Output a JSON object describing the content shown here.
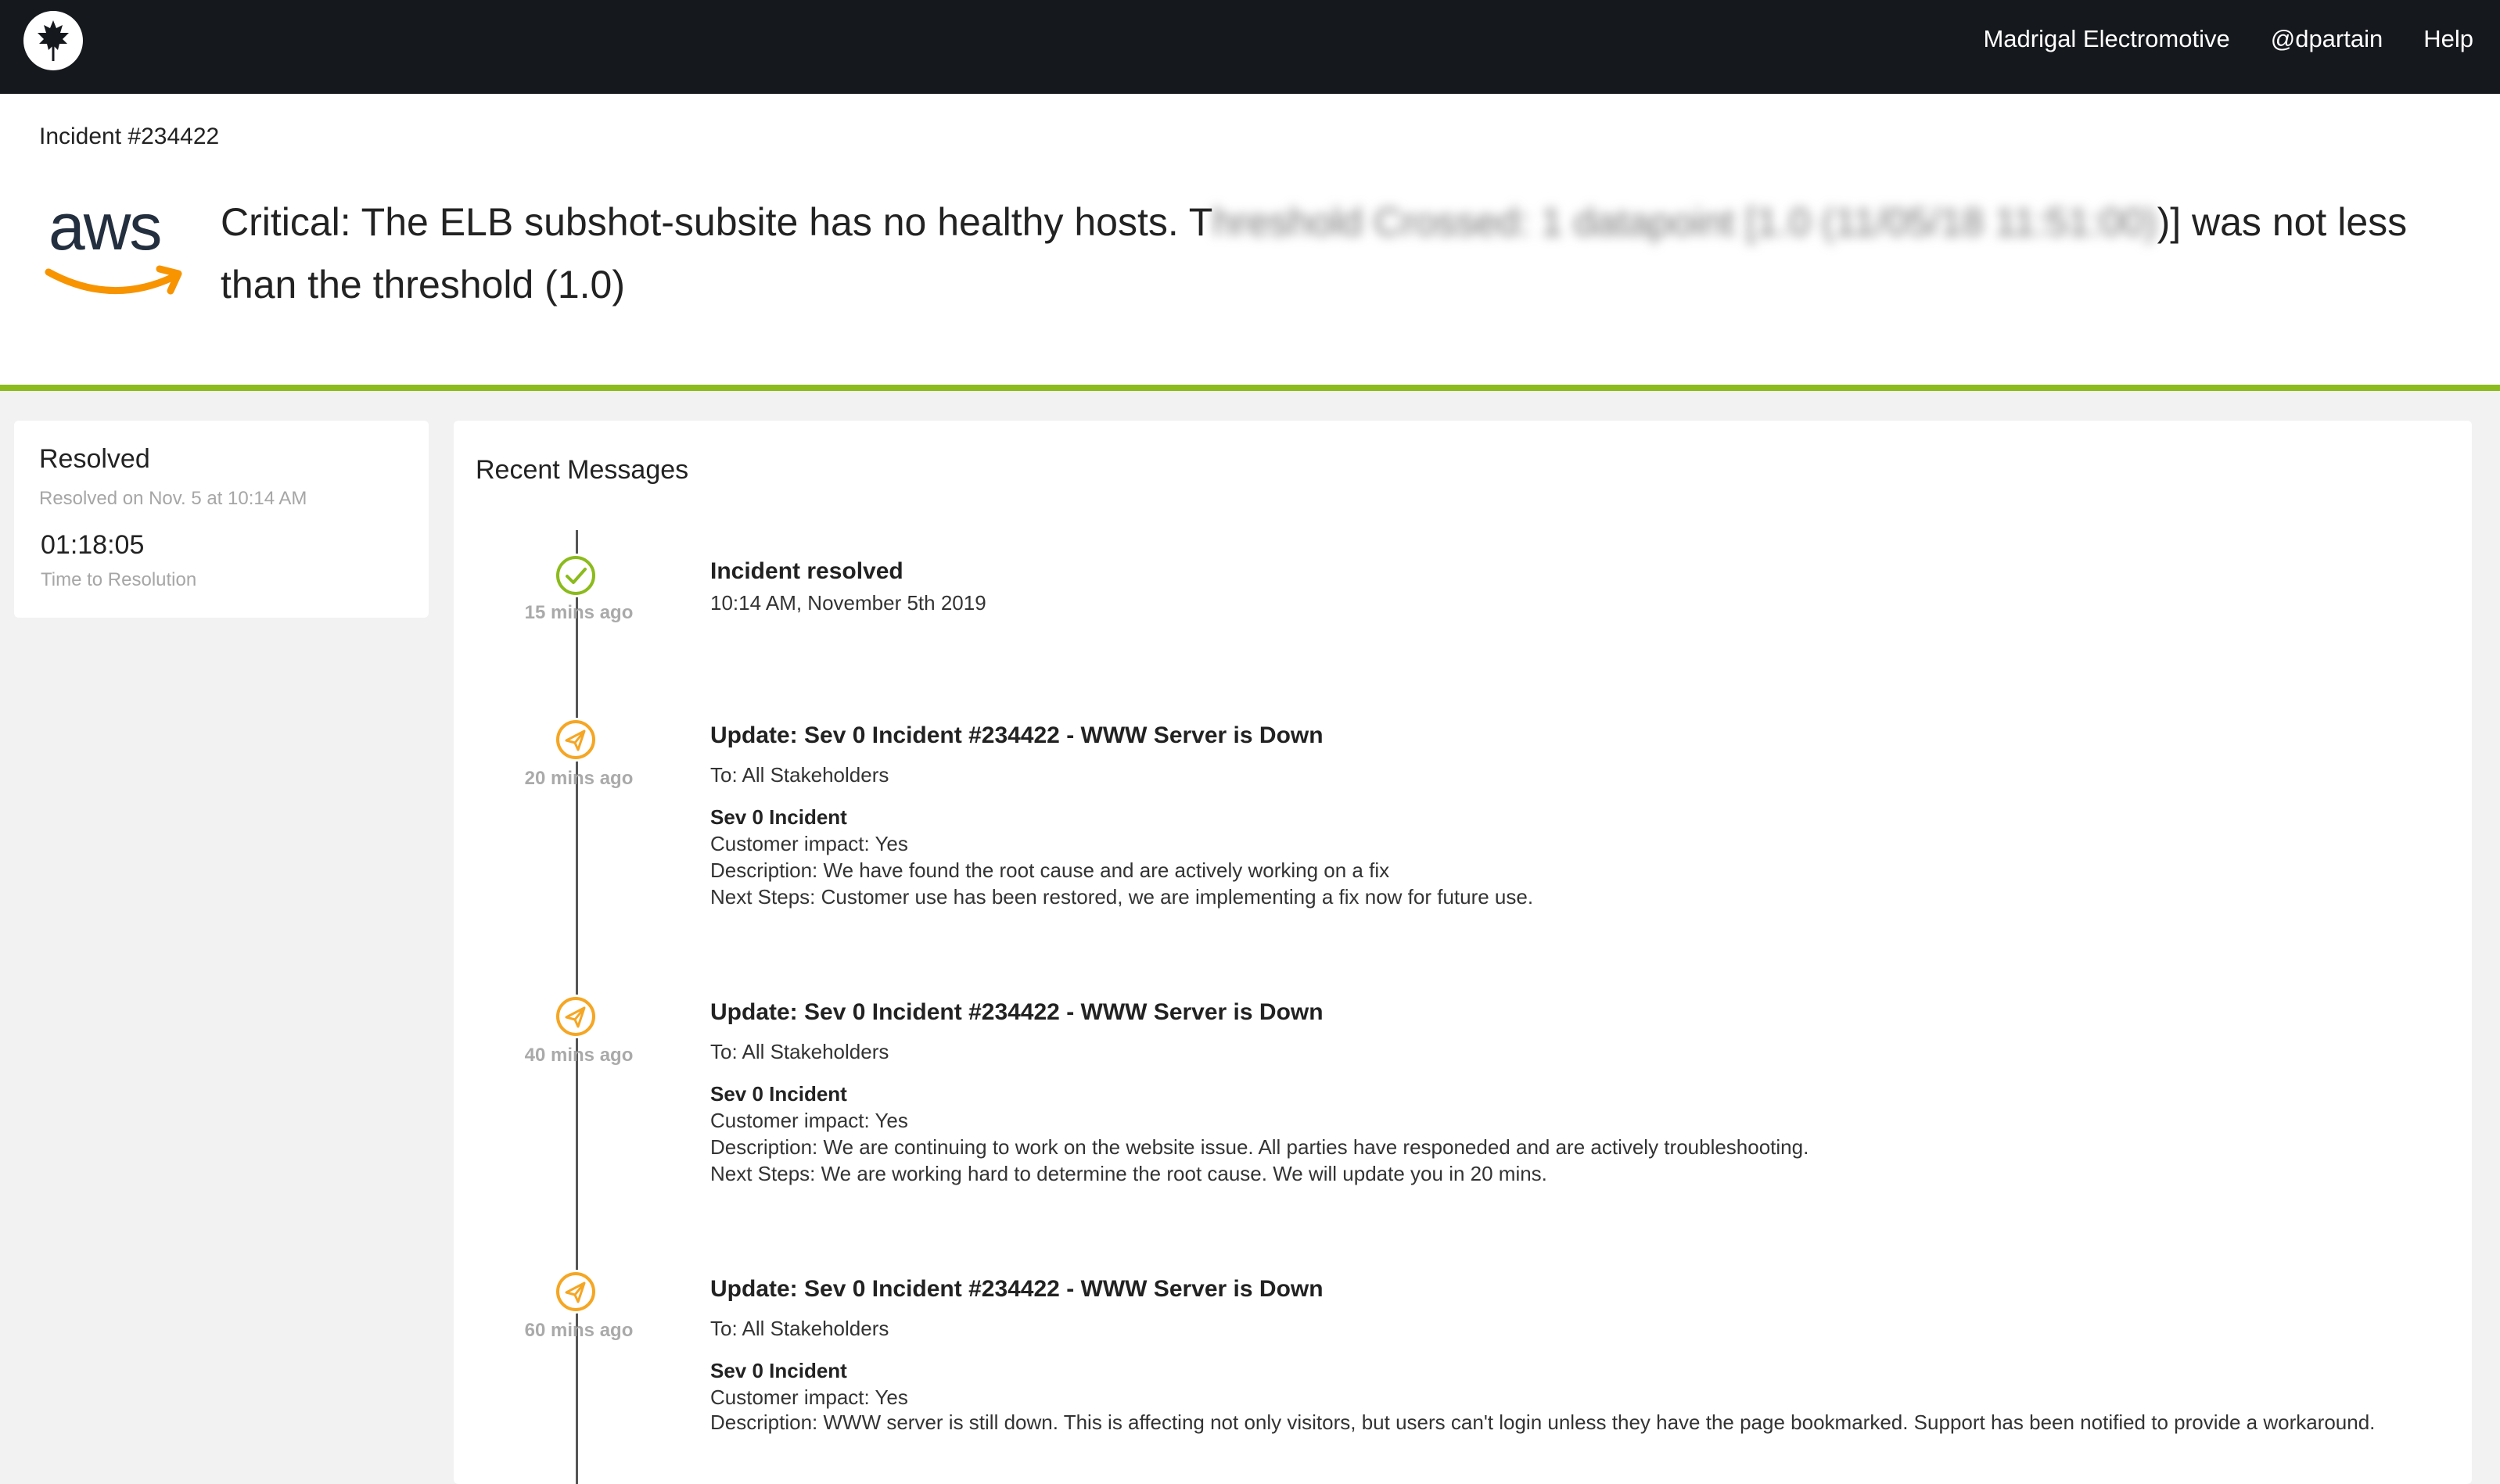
{
  "nav": {
    "org": "Madrigal Electromotive",
    "user": "@dpartain",
    "help": "Help"
  },
  "header": {
    "incident_id": "Incident #234422",
    "logo_text": "aws",
    "headline_start": "Critical: The ELB subshot-subsite has no healthy hosts. T",
    "headline_blurred": "hreshold Crossed: 1 datapoint [1.0 (11/05/18 11:51:00)",
    "headline_end": ")] was not less than the threshold (1.0)"
  },
  "status": {
    "title": "Resolved",
    "resolved_on": "Resolved on Nov. 5 at 10:14 AM",
    "ttr_value": "01:18:05",
    "ttr_label": "Time to Resolution"
  },
  "messages": {
    "title": "Recent Messages",
    "entries": [
      {
        "icon": "check-circle-icon",
        "ago": "15 mins ago",
        "title": "Incident resolved",
        "time": "10:14 AM, November 5th 2019"
      },
      {
        "icon": "paper-plane-icon",
        "ago": "20 mins ago",
        "title": "Update: Sev 0 Incident #234422 - WWW Server is Down",
        "to": "To: All Stakeholders",
        "sev": "Sev 0 Incident",
        "impact": "Customer impact: Yes",
        "description": "Description: We have found the root cause and are actively working on a fix",
        "next": "Next Steps: Customer use has been restored, we are implementing a fix now for future use."
      },
      {
        "icon": "paper-plane-icon",
        "ago": "40 mins ago",
        "title": "Update: Sev 0 Incident #234422 - WWW Server is Down",
        "to": "To: All Stakeholders",
        "sev": "Sev 0 Incident",
        "impact": "Customer impact: Yes",
        "description": "Description: We are continuing to work on the website issue. All parties have responeded and are actively troubleshooting.",
        "next": "Next Steps: We are working hard to determine the root cause. We will update you in 20 mins."
      },
      {
        "icon": "paper-plane-icon",
        "ago": "60 mins ago",
        "title": "Update: Sev 0 Incident #234422 - WWW Server is Down",
        "to": "To: All Stakeholders",
        "sev": "Sev 0 Incident",
        "impact": "Customer impact: Yes",
        "description": "Description: WWW server is still down. This is affecting not only visitors, but users can't login unless they have the page bookmarked. Support has been notified to provide a workaround."
      }
    ]
  },
  "colors": {
    "accent_green": "#8bbb1c",
    "update_orange": "#f5a623",
    "topbar": "#15181c"
  }
}
